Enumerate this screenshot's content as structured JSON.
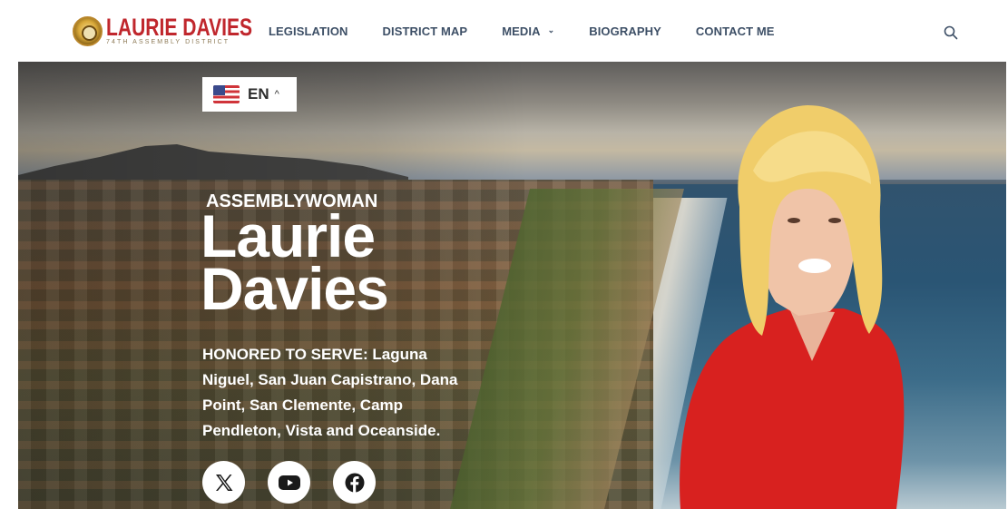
{
  "header": {
    "logo": {
      "name": "LAURIE DAVIES",
      "subtitle": "74TH ASSEMBLY DISTRICT"
    },
    "nav": [
      {
        "label": "LEGISLATION"
      },
      {
        "label": "DISTRICT MAP"
      },
      {
        "label": "MEDIA",
        "has_dropdown": true,
        "icon": "chevron-down-icon"
      },
      {
        "label": "BIOGRAPHY"
      },
      {
        "label": "CONTACT ME"
      }
    ],
    "search_icon": "search-icon"
  },
  "language_selector": {
    "flag": "us-flag-icon",
    "code": "EN",
    "caret": "^"
  },
  "hero": {
    "kicker": "ASSEMBLYWOMAN",
    "name_line1": "Laurie",
    "name_line2": "Davies",
    "tagline": "HONORED TO SERVE: Laguna Niguel, San Juan Capistrano, Dana Point, San Clemente, Camp Pendleton, Vista and Oceanside.",
    "social_icons": [
      "x-icon",
      "youtube-icon",
      "facebook-icon"
    ]
  },
  "colors": {
    "brand_red": "#c0272d",
    "nav_text": "#3d4f66",
    "hero_text": "#ffffff",
    "dress_red": "#d8211f"
  }
}
